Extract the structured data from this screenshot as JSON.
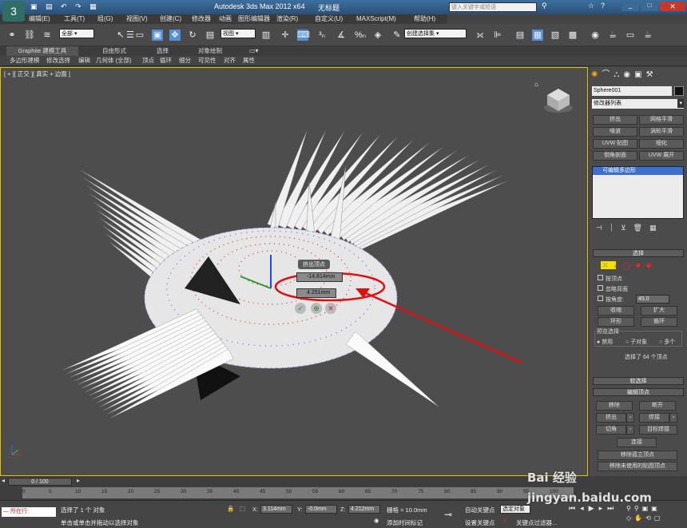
{
  "window": {
    "title": "Autodesk 3ds Max  2012 x64",
    "file": "无标题",
    "search_placeholder": "键入关键字或短语"
  },
  "menu": [
    "编辑(E)",
    "工具(T)",
    "组(G)",
    "视图(V)",
    "创建(C)",
    "修改器",
    "动画",
    "图形编辑器",
    "渲染(R)",
    "自定义(U)",
    "MAXScript(M)",
    "帮助(H)"
  ],
  "toolbar": {
    "selection_filter": "全部",
    "ref_coord": "视图",
    "named_selection": "创建选择集"
  },
  "ribbon": {
    "tabs": [
      "Graphite 建模工具",
      "自由形式",
      "选择",
      "对象绘制"
    ],
    "items": [
      "多边形建模",
      "修改选择",
      "编辑",
      "几何体 (全部)",
      "顶点",
      "循环",
      "细分",
      "可见性",
      "对齐",
      "属性"
    ]
  },
  "viewport": {
    "label": "[ + ][ 正交 ][ 真实 + 边面 ]",
    "caddy_title": "挤出顶点",
    "height_value": "-14.814mm",
    "width_value": "4.251mm"
  },
  "command_panel": {
    "object_name": "Sphere001",
    "modifier_list": "修改器列表",
    "mod_buttons": [
      "挤出",
      "网格平滑",
      "噪波",
      "涡轮平滑",
      "UVW 贴图",
      "细化",
      "倒角剖面",
      "UVW 展开"
    ],
    "stack_item": "可编辑多边形",
    "selection": {
      "title": "选择",
      "by_vertex": "按顶点",
      "ignore_backface": "忽略背面",
      "by_angle": "按角度:",
      "angle": "45.0",
      "shrink": "收缩",
      "grow": "扩大",
      "ring": "环形",
      "loop": "循环",
      "preview": "预览选择",
      "disabled": "禁用",
      "subobject": "子对象",
      "multi": "多个",
      "selected_info": "选择了 64 个顶点"
    },
    "soft_selection": "软选择",
    "edit_vertices": {
      "title": "编辑顶点",
      "remove": "移除",
      "break": "断开",
      "extrude": "挤出",
      "weld": "焊接",
      "chamfer": "切角",
      "target_weld": "目标焊接",
      "connect": "连接",
      "remove_isolated": "移除孤立顶点",
      "remove_unused": "移除未使用的贴图顶点"
    }
  },
  "timeline": {
    "frame": "0 / 100",
    "ticks": [
      "0",
      "5",
      "10",
      "15",
      "20",
      "25",
      "30",
      "35",
      "40",
      "45",
      "50",
      "55",
      "60",
      "65",
      "70",
      "75",
      "80",
      "85",
      "90",
      "95",
      "100"
    ]
  },
  "status": {
    "mode": "所在行:",
    "selected": "选择了 1 个 对象",
    "prompt": "单击或单击并拖动以选择对象",
    "x": "3.114mm",
    "y": "-0.0mm",
    "z": "4.212mm",
    "grid": "栅格 = 10.0mm",
    "auto_key": "自动关键点",
    "set_key": "设置关键点",
    "selected_obj": "选定对象",
    "key_filters": "关键点过滤器...",
    "add_time_tag": "添加时间标记"
  },
  "watermark": "Bai 经验 jingyan.baidu.com"
}
